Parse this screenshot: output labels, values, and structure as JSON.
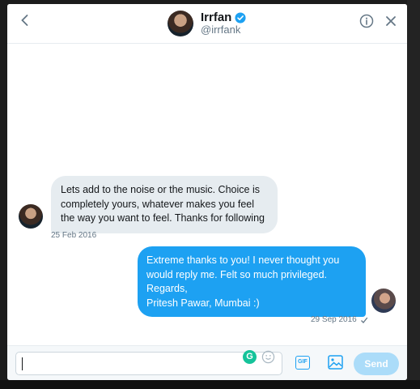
{
  "header": {
    "name": "Irrfan",
    "handle": "@irrfank"
  },
  "messages": [
    {
      "direction": "incoming",
      "text": "Lets add to the noise or the music. Choice is completely yours, whatever makes you feel the way you want to feel. Thanks for following",
      "timestamp": "25 Feb 2016"
    },
    {
      "direction": "outgoing",
      "lines": [
        "Extreme thanks to you! I never thought you would reply me. Felt so much privileged.",
        "Regards,",
        "Pritesh Pawar, Mumbai :)"
      ],
      "timestamp": "29 Sep 2016"
    }
  ],
  "composer": {
    "value": "",
    "grammarly_letter": "G",
    "gif_label": "GIF",
    "send_label": "Send"
  },
  "icons": {
    "back": "chevron-left-icon",
    "verified": "verified-badge-icon",
    "info": "info-icon",
    "close": "close-icon",
    "emoji": "emoji-icon",
    "media": "image-icon",
    "read_receipt": "checkmark-icon"
  },
  "colors": {
    "accent": "#1da1f2",
    "incoming_bubble": "#e6ecf0",
    "send_disabled": "#a4d9f9"
  }
}
